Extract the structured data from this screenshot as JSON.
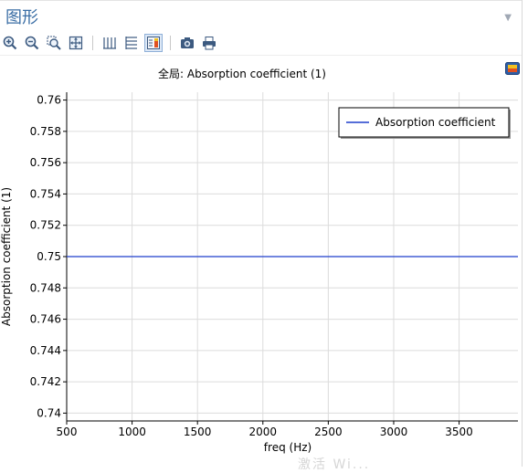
{
  "window": {
    "title": "图形"
  },
  "toolbar": {
    "buttons": [
      {
        "icon": "zoom-in-icon",
        "label": "Zoom In"
      },
      {
        "icon": "zoom-out-icon",
        "label": "Zoom Out"
      },
      {
        "icon": "zoom-box-icon",
        "label": "Zoom Box"
      },
      {
        "icon": "zoom-extents-icon",
        "label": "Zoom Extents"
      },
      {
        "icon": "x-grid-icon",
        "label": "x-Axis Grid"
      },
      {
        "icon": "y-grid-icon",
        "label": "y-Axis Grid"
      },
      {
        "icon": "legend-toggle-icon",
        "label": "Show Legends"
      },
      {
        "icon": "camera-icon",
        "label": "Image Snapshot"
      },
      {
        "icon": "print-icon",
        "label": "Print"
      }
    ]
  },
  "watermark": "激活 Wi...",
  "chart_data": {
    "type": "line",
    "title": "全局: Absorption coefficient (1)",
    "xlabel": "freq (Hz)",
    "ylabel": "Absorption coefficient (1)",
    "xlim": [
      500,
      3950
    ],
    "ylim": [
      0.7395,
      0.7605
    ],
    "x_ticks": [
      500,
      1000,
      1500,
      2000,
      2500,
      3000,
      3500
    ],
    "y_ticks": [
      0.74,
      0.742,
      0.744,
      0.746,
      0.748,
      0.75,
      0.752,
      0.754,
      0.756,
      0.758,
      0.76
    ],
    "y_tick_labels": [
      "0.74",
      "0.742",
      "0.744",
      "0.746",
      "0.748",
      "0.75",
      "0.752",
      "0.754",
      "0.756",
      "0.758",
      "0.76"
    ],
    "grid": true,
    "legend_position": "top-right",
    "series": [
      {
        "name": "Absorption coefficient",
        "color": "#1f3fcc",
        "x": [
          500,
          3950
        ],
        "y": [
          0.75,
          0.75
        ]
      }
    ]
  }
}
